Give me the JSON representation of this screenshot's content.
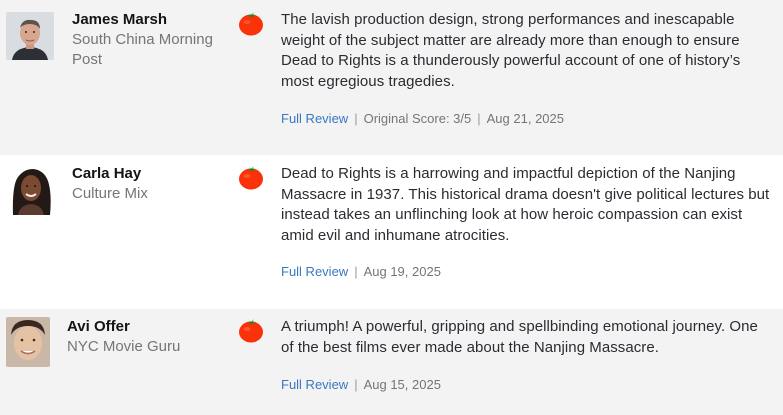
{
  "reviews": [
    {
      "critic": "James Marsh",
      "publication": "South China Morning Post",
      "quote": "The lavish production design, strong performances and inescapable weight of the subject matter are already more than enough to ensure Dead to Rights is a thunderously powerful account of one of history’s most egregious tragedies.",
      "link_label": "Full Review",
      "score": "Original Score: 3/5",
      "date": "Aug 21, 2025",
      "rating_icon": "fresh-tomato-icon"
    },
    {
      "critic": "Carla Hay",
      "publication": "Culture Mix",
      "quote": "Dead to Rights is a harrowing and impactful depiction of the Nanjing Massacre in 1937. This historical drama doesn't give political lectures but instead takes an unflinching look at how heroic compassion can exist amid evil and inhumane atrocities.",
      "link_label": "Full Review",
      "date": "Aug 19, 2025",
      "rating_icon": "fresh-tomato-icon"
    },
    {
      "critic": "Avi Offer",
      "publication": "NYC Movie Guru",
      "quote": "A triumph! A powerful, gripping and spellbinding emotional journey. One of the best films ever made about the Nanjing Massacre.",
      "link_label": "Full Review",
      "date": "Aug 15, 2025",
      "rating_icon": "fresh-tomato-icon"
    }
  ],
  "colors": {
    "shaded_row": "#f3f3f3",
    "link": "#3a78c2",
    "tomato": "#fa320a"
  }
}
